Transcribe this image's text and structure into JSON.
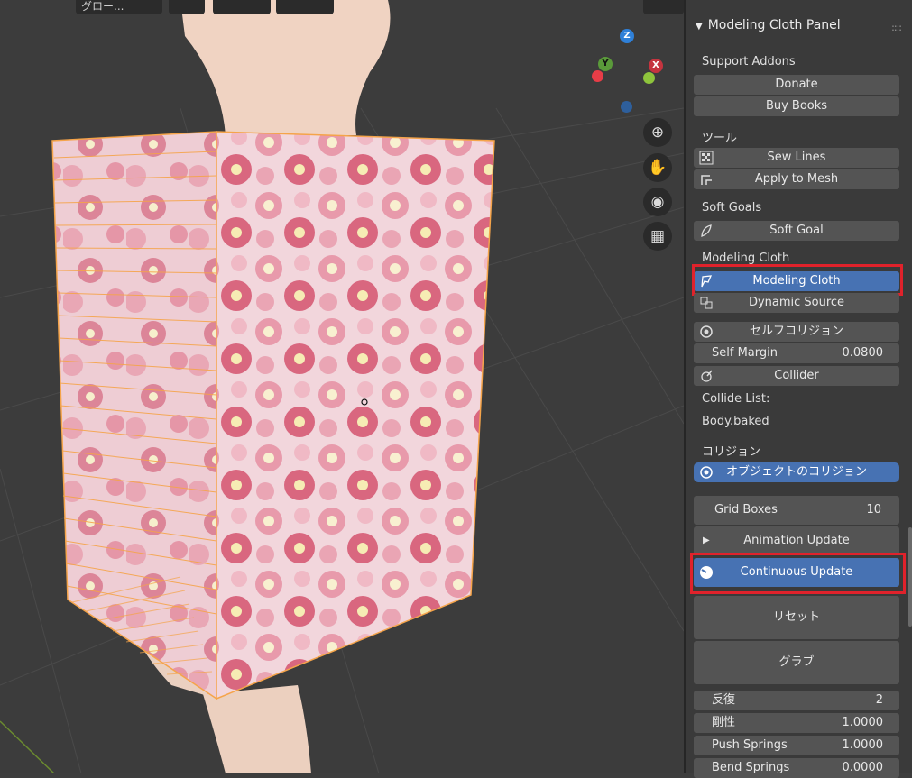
{
  "header": {
    "mode_label": "グロー...",
    "snap_label": "▾"
  },
  "viewport": {
    "gizmo": {
      "z": "Z",
      "y": "Y",
      "x": "X"
    },
    "nav_icons": [
      "zoom-icon",
      "hand-pan-icon",
      "camera-icon",
      "grid-icon"
    ]
  },
  "panel": {
    "title": "Modeling Cloth Panel",
    "support_addons": {
      "label": "Support Addons",
      "donate": "Donate",
      "buy_books": "Buy Books"
    },
    "tools": {
      "label": "ツール",
      "sew_lines": "Sew Lines",
      "apply_to_mesh": "Apply to Mesh"
    },
    "soft_goals": {
      "label": "Soft Goals",
      "soft_goal": "Soft Goal"
    },
    "modeling_cloth": {
      "label": "Modeling Cloth",
      "modeling_cloth_btn": "Modeling Cloth",
      "dynamic_source": "Dynamic Source"
    },
    "self_collision": {
      "label": "セルフコリジョン",
      "self_margin_label": "Self Margin",
      "self_margin_value": "0.0800",
      "collider": "Collider"
    },
    "collide_list": {
      "label": "Collide List:",
      "item": "Body.baked"
    },
    "collision": {
      "label": "コリジョン",
      "object_collision": "オブジェクトのコリジョン"
    },
    "grid_boxes": {
      "label": "Grid Boxes",
      "value": "10"
    },
    "animation_update": "Animation Update",
    "continuous_update": "Continuous Update",
    "reset": "リセット",
    "grab": "グラブ",
    "iterations": {
      "label": "反復",
      "value": "2"
    },
    "stiffness": {
      "label": "剛性",
      "value": "1.0000"
    },
    "push_springs": {
      "label": "Push Springs",
      "value": "1.0000"
    },
    "bend_springs": {
      "label": "Bend Springs",
      "value": "0.0000"
    }
  },
  "colors": {
    "active_blue": "#4772b3",
    "highlight_red": "#e0222b",
    "selection_orange": "#f5a44a"
  }
}
